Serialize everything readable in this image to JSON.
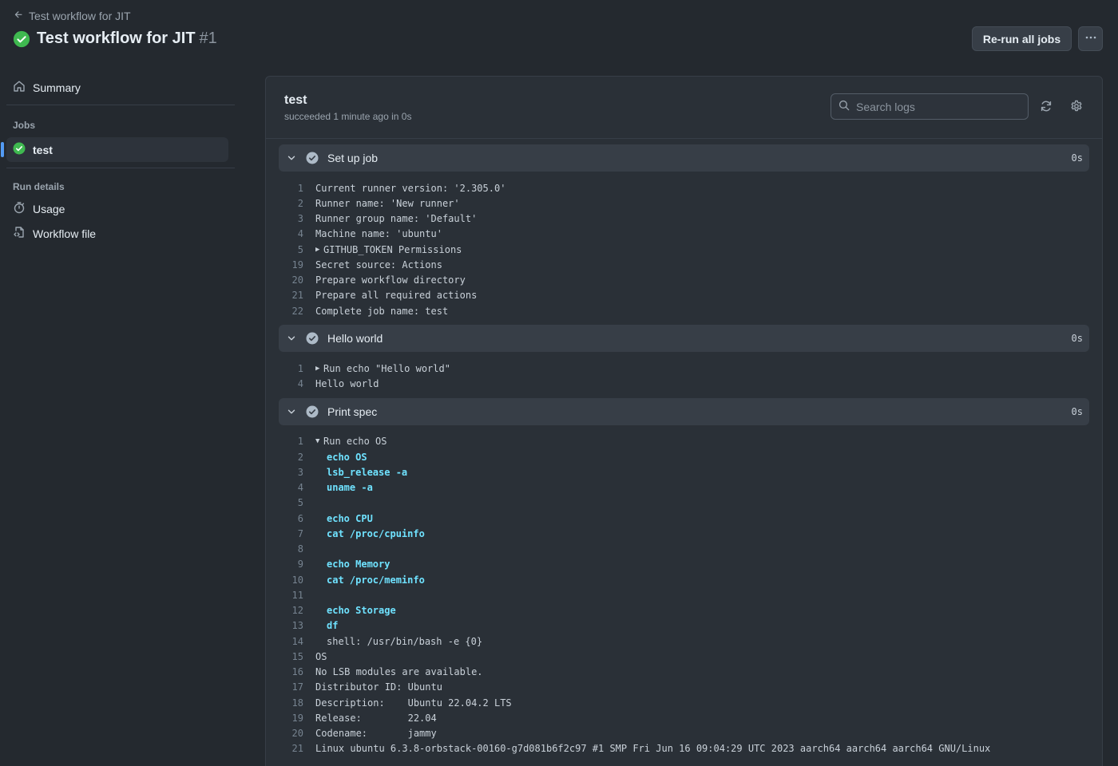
{
  "header": {
    "back_label": "Test workflow for JIT",
    "title": "Test workflow for JIT",
    "run_number": "#1",
    "rerun_label": "Re-run all jobs"
  },
  "sidebar": {
    "summary_label": "Summary",
    "jobs_heading": "Jobs",
    "job_label": "test",
    "run_details_heading": "Run details",
    "usage_label": "Usage",
    "workflow_file_label": "Workflow file"
  },
  "job": {
    "name": "test",
    "status": "succeeded 1 minute ago in 0s",
    "search_placeholder": "Search logs"
  },
  "steps": [
    {
      "title": "Set up job",
      "time": "0s",
      "lines": [
        {
          "n": "1",
          "t": "Current runner version: '2.305.0'",
          "k": "plain"
        },
        {
          "n": "2",
          "t": "Runner name: 'New runner'",
          "k": "plain"
        },
        {
          "n": "3",
          "t": "Runner group name: 'Default'",
          "k": "plain"
        },
        {
          "n": "4",
          "t": "Machine name: 'ubuntu'",
          "k": "plain"
        },
        {
          "n": "5",
          "t": "GITHUB_TOKEN Permissions",
          "k": "collapsed"
        },
        {
          "n": "19",
          "t": "Secret source: Actions",
          "k": "plain"
        },
        {
          "n": "20",
          "t": "Prepare workflow directory",
          "k": "plain"
        },
        {
          "n": "21",
          "t": "Prepare all required actions",
          "k": "plain"
        },
        {
          "n": "22",
          "t": "Complete job name: test",
          "k": "plain"
        }
      ]
    },
    {
      "title": "Hello world",
      "time": "0s",
      "lines": [
        {
          "n": "1",
          "t": "Run echo \"Hello world\"",
          "k": "collapsed"
        },
        {
          "n": "4",
          "t": "Hello world",
          "k": "plain"
        }
      ]
    },
    {
      "title": "Print spec",
      "time": "0s",
      "lines": [
        {
          "n": "1",
          "t": "Run echo OS",
          "k": "expanded"
        },
        {
          "n": "2",
          "t": "echo OS",
          "k": "cmd"
        },
        {
          "n": "3",
          "t": "lsb_release -a",
          "k": "cmd"
        },
        {
          "n": "4",
          "t": "uname -a",
          "k": "cmd"
        },
        {
          "n": "5",
          "t": "",
          "k": "plain"
        },
        {
          "n": "6",
          "t": "echo CPU",
          "k": "cmd"
        },
        {
          "n": "7",
          "t": "cat /proc/cpuinfo",
          "k": "cmd"
        },
        {
          "n": "8",
          "t": "",
          "k": "plain"
        },
        {
          "n": "9",
          "t": "echo Memory",
          "k": "cmd"
        },
        {
          "n": "10",
          "t": "cat /proc/meminfo",
          "k": "cmd"
        },
        {
          "n": "11",
          "t": "",
          "k": "plain"
        },
        {
          "n": "12",
          "t": "echo Storage",
          "k": "cmd"
        },
        {
          "n": "13",
          "t": "df",
          "k": "cmd"
        },
        {
          "n": "14",
          "t": "shell: /usr/bin/bash -e {0}",
          "k": "indent"
        },
        {
          "n": "15",
          "t": "OS",
          "k": "plain"
        },
        {
          "n": "16",
          "t": "No LSB modules are available.",
          "k": "plain"
        },
        {
          "n": "17",
          "t": "Distributor ID:\tUbuntu",
          "k": "plain"
        },
        {
          "n": "18",
          "t": "Description:    Ubuntu 22.04.2 LTS",
          "k": "plain"
        },
        {
          "n": "19",
          "t": "Release:        22.04",
          "k": "plain"
        },
        {
          "n": "20",
          "t": "Codename:       jammy",
          "k": "plain"
        },
        {
          "n": "21",
          "t": "Linux ubuntu 6.3.8-orbstack-00160-g7d081b6f2c97 #1 SMP Fri Jun 16 09:04:29 UTC 2023 aarch64 aarch64 aarch64 GNU/Linux",
          "k": "plain"
        }
      ]
    }
  ],
  "colors": {
    "success": "#3fb950",
    "accent": "#539bf5",
    "command": "#6fe2ff"
  }
}
